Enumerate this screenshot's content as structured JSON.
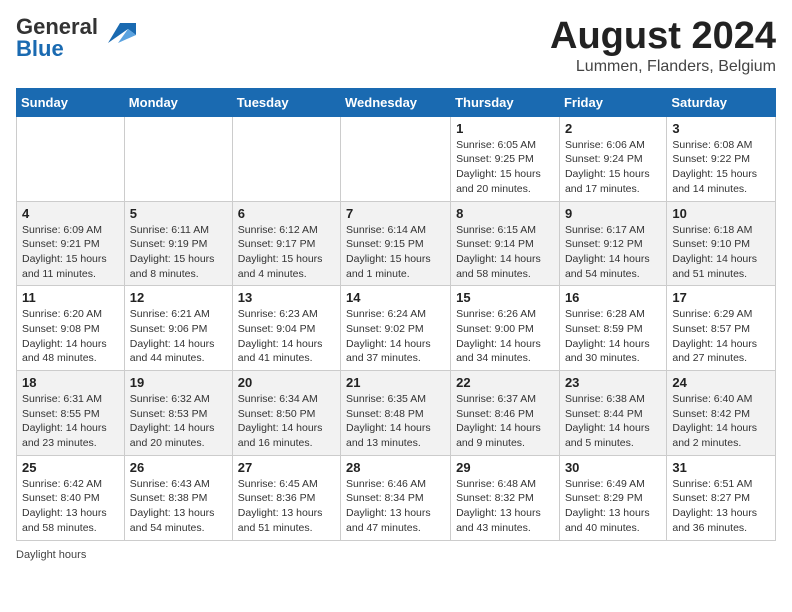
{
  "header": {
    "logo_general": "General",
    "logo_blue": "Blue",
    "month_title": "August 2024",
    "location": "Lummen, Flanders, Belgium"
  },
  "days_of_week": [
    "Sunday",
    "Monday",
    "Tuesday",
    "Wednesday",
    "Thursday",
    "Friday",
    "Saturday"
  ],
  "weeks": [
    [
      {
        "day": "",
        "info": ""
      },
      {
        "day": "",
        "info": ""
      },
      {
        "day": "",
        "info": ""
      },
      {
        "day": "",
        "info": ""
      },
      {
        "day": "1",
        "info": "Sunrise: 6:05 AM\nSunset: 9:25 PM\nDaylight: 15 hours and 20 minutes."
      },
      {
        "day": "2",
        "info": "Sunrise: 6:06 AM\nSunset: 9:24 PM\nDaylight: 15 hours and 17 minutes."
      },
      {
        "day": "3",
        "info": "Sunrise: 6:08 AM\nSunset: 9:22 PM\nDaylight: 15 hours and 14 minutes."
      }
    ],
    [
      {
        "day": "4",
        "info": "Sunrise: 6:09 AM\nSunset: 9:21 PM\nDaylight: 15 hours and 11 minutes."
      },
      {
        "day": "5",
        "info": "Sunrise: 6:11 AM\nSunset: 9:19 PM\nDaylight: 15 hours and 8 minutes."
      },
      {
        "day": "6",
        "info": "Sunrise: 6:12 AM\nSunset: 9:17 PM\nDaylight: 15 hours and 4 minutes."
      },
      {
        "day": "7",
        "info": "Sunrise: 6:14 AM\nSunset: 9:15 PM\nDaylight: 15 hours and 1 minute."
      },
      {
        "day": "8",
        "info": "Sunrise: 6:15 AM\nSunset: 9:14 PM\nDaylight: 14 hours and 58 minutes."
      },
      {
        "day": "9",
        "info": "Sunrise: 6:17 AM\nSunset: 9:12 PM\nDaylight: 14 hours and 54 minutes."
      },
      {
        "day": "10",
        "info": "Sunrise: 6:18 AM\nSunset: 9:10 PM\nDaylight: 14 hours and 51 minutes."
      }
    ],
    [
      {
        "day": "11",
        "info": "Sunrise: 6:20 AM\nSunset: 9:08 PM\nDaylight: 14 hours and 48 minutes."
      },
      {
        "day": "12",
        "info": "Sunrise: 6:21 AM\nSunset: 9:06 PM\nDaylight: 14 hours and 44 minutes."
      },
      {
        "day": "13",
        "info": "Sunrise: 6:23 AM\nSunset: 9:04 PM\nDaylight: 14 hours and 41 minutes."
      },
      {
        "day": "14",
        "info": "Sunrise: 6:24 AM\nSunset: 9:02 PM\nDaylight: 14 hours and 37 minutes."
      },
      {
        "day": "15",
        "info": "Sunrise: 6:26 AM\nSunset: 9:00 PM\nDaylight: 14 hours and 34 minutes."
      },
      {
        "day": "16",
        "info": "Sunrise: 6:28 AM\nSunset: 8:59 PM\nDaylight: 14 hours and 30 minutes."
      },
      {
        "day": "17",
        "info": "Sunrise: 6:29 AM\nSunset: 8:57 PM\nDaylight: 14 hours and 27 minutes."
      }
    ],
    [
      {
        "day": "18",
        "info": "Sunrise: 6:31 AM\nSunset: 8:55 PM\nDaylight: 14 hours and 23 minutes."
      },
      {
        "day": "19",
        "info": "Sunrise: 6:32 AM\nSunset: 8:53 PM\nDaylight: 14 hours and 20 minutes."
      },
      {
        "day": "20",
        "info": "Sunrise: 6:34 AM\nSunset: 8:50 PM\nDaylight: 14 hours and 16 minutes."
      },
      {
        "day": "21",
        "info": "Sunrise: 6:35 AM\nSunset: 8:48 PM\nDaylight: 14 hours and 13 minutes."
      },
      {
        "day": "22",
        "info": "Sunrise: 6:37 AM\nSunset: 8:46 PM\nDaylight: 14 hours and 9 minutes."
      },
      {
        "day": "23",
        "info": "Sunrise: 6:38 AM\nSunset: 8:44 PM\nDaylight: 14 hours and 5 minutes."
      },
      {
        "day": "24",
        "info": "Sunrise: 6:40 AM\nSunset: 8:42 PM\nDaylight: 14 hours and 2 minutes."
      }
    ],
    [
      {
        "day": "25",
        "info": "Sunrise: 6:42 AM\nSunset: 8:40 PM\nDaylight: 13 hours and 58 minutes."
      },
      {
        "day": "26",
        "info": "Sunrise: 6:43 AM\nSunset: 8:38 PM\nDaylight: 13 hours and 54 minutes."
      },
      {
        "day": "27",
        "info": "Sunrise: 6:45 AM\nSunset: 8:36 PM\nDaylight: 13 hours and 51 minutes."
      },
      {
        "day": "28",
        "info": "Sunrise: 6:46 AM\nSunset: 8:34 PM\nDaylight: 13 hours and 47 minutes."
      },
      {
        "day": "29",
        "info": "Sunrise: 6:48 AM\nSunset: 8:32 PM\nDaylight: 13 hours and 43 minutes."
      },
      {
        "day": "30",
        "info": "Sunrise: 6:49 AM\nSunset: 8:29 PM\nDaylight: 13 hours and 40 minutes."
      },
      {
        "day": "31",
        "info": "Sunrise: 6:51 AM\nSunset: 8:27 PM\nDaylight: 13 hours and 36 minutes."
      }
    ]
  ],
  "footer": {
    "note": "Daylight hours"
  }
}
